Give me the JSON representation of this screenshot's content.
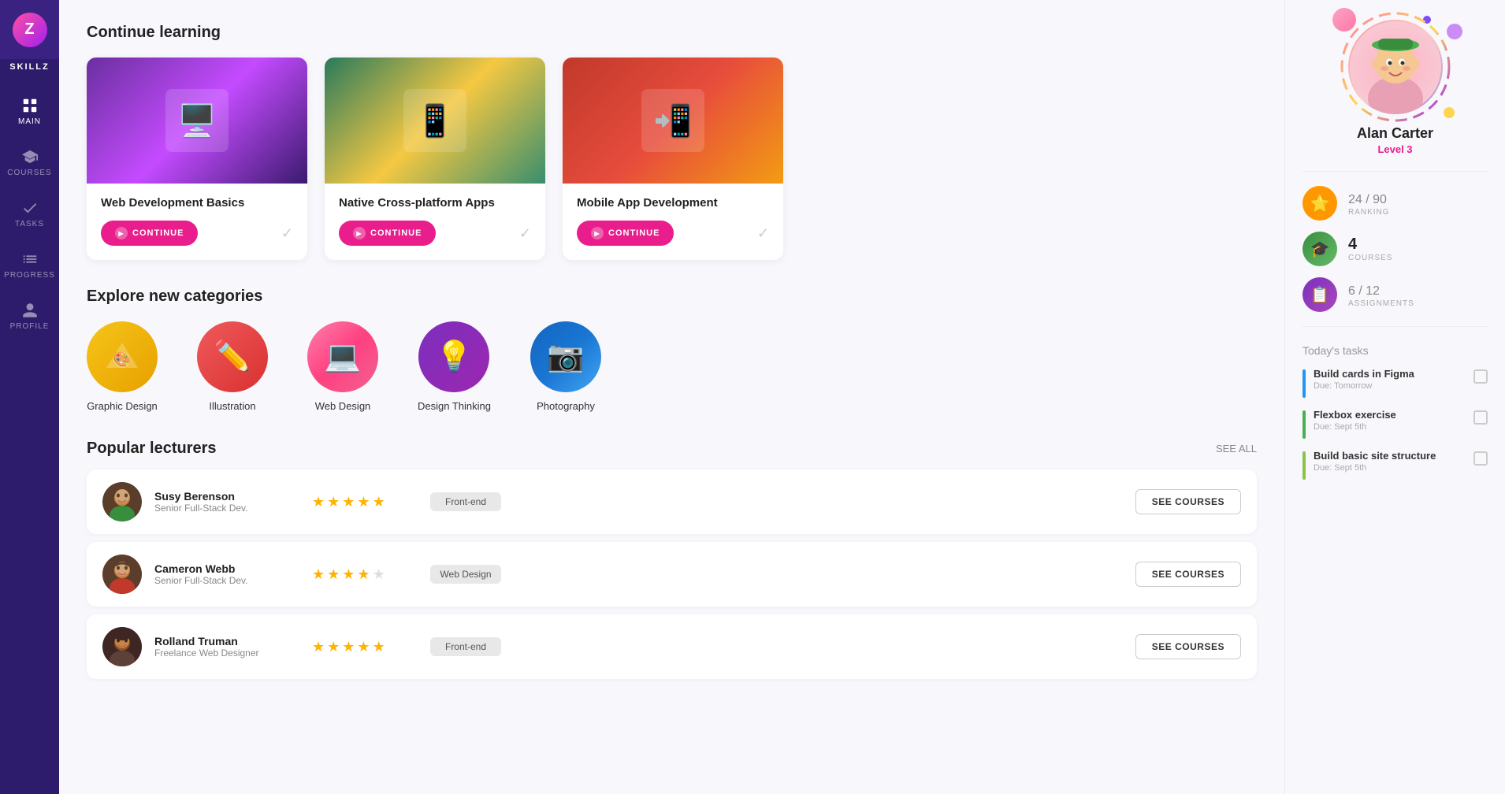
{
  "app": {
    "name": "SKILLZ"
  },
  "sidebar": {
    "items": [
      {
        "id": "main",
        "label": "MAIN",
        "icon": "⊞"
      },
      {
        "id": "courses",
        "label": "COURSES",
        "icon": "🎓"
      },
      {
        "id": "tasks",
        "label": "TASKS",
        "icon": "✓"
      },
      {
        "id": "progress",
        "label": "PROGRESS",
        "icon": "📊"
      },
      {
        "id": "profile",
        "label": "PROFILE",
        "icon": "👤"
      }
    ]
  },
  "main": {
    "continue_title": "Continue learning",
    "courses": [
      {
        "title": "Web Development Basics",
        "thumb_class": "thumb-web",
        "continue_label": "CONTINUE"
      },
      {
        "title": "Native Cross-platform Apps",
        "thumb_class": "thumb-native",
        "continue_label": "CONTINUE"
      },
      {
        "title": "Mobile App Development",
        "thumb_class": "thumb-mobile",
        "continue_label": "CONTINUE"
      }
    ],
    "explore_title": "Explore new categories",
    "categories": [
      {
        "label": "Graphic Design",
        "icon": "🎨",
        "class": "cat-graphic"
      },
      {
        "label": "Illustration",
        "icon": "✏️",
        "class": "cat-illustration"
      },
      {
        "label": "Web Design",
        "icon": "💻",
        "class": "cat-webdesign"
      },
      {
        "label": "Design Thinking",
        "icon": "💡",
        "class": "cat-thinking"
      },
      {
        "label": "Photography",
        "icon": "📷",
        "class": "cat-photography"
      }
    ],
    "lecturers_title": "Popular lecturers",
    "see_all": "SEE ALL",
    "lecturers": [
      {
        "name": "Susy Berenson",
        "role": "Senior Full-Stack Dev.",
        "stars": 5,
        "tag": "Front-end",
        "avatar_class": "avatar-susy",
        "avatar_emoji": "👩"
      },
      {
        "name": "Cameron Webb",
        "role": "Senior Full-Stack Dev.",
        "stars": 4,
        "tag": "Web Design",
        "avatar_class": "avatar-cameron",
        "avatar_emoji": "👨"
      },
      {
        "name": "Rolland Truman",
        "role": "Freelance Web Designer",
        "stars": 5,
        "tag": "Front-end",
        "avatar_class": "avatar-rolland",
        "avatar_emoji": "🧑"
      }
    ],
    "see_courses_label": "SEE COURSES"
  },
  "profile": {
    "name": "Alan Carter",
    "level": "Level 3",
    "ranking_value": "24",
    "ranking_total": "90",
    "ranking_label": "RANKING",
    "courses_value": "4",
    "courses_label": "COURSES",
    "assignments_value": "6",
    "assignments_total": "12",
    "assignments_label": "ASSIGNMENTS"
  },
  "tasks": {
    "title": "Today's tasks",
    "items": [
      {
        "name": "Build cards in Figma",
        "due": "Due: Tomorrow",
        "bar": "task-bar-blue"
      },
      {
        "name": "Flexbox exercise",
        "due": "Due: Sept 5th",
        "bar": "task-bar-green"
      },
      {
        "name": "Build basic site structure",
        "due": "Due: Sept 5th",
        "bar": "task-bar-green2"
      }
    ]
  }
}
